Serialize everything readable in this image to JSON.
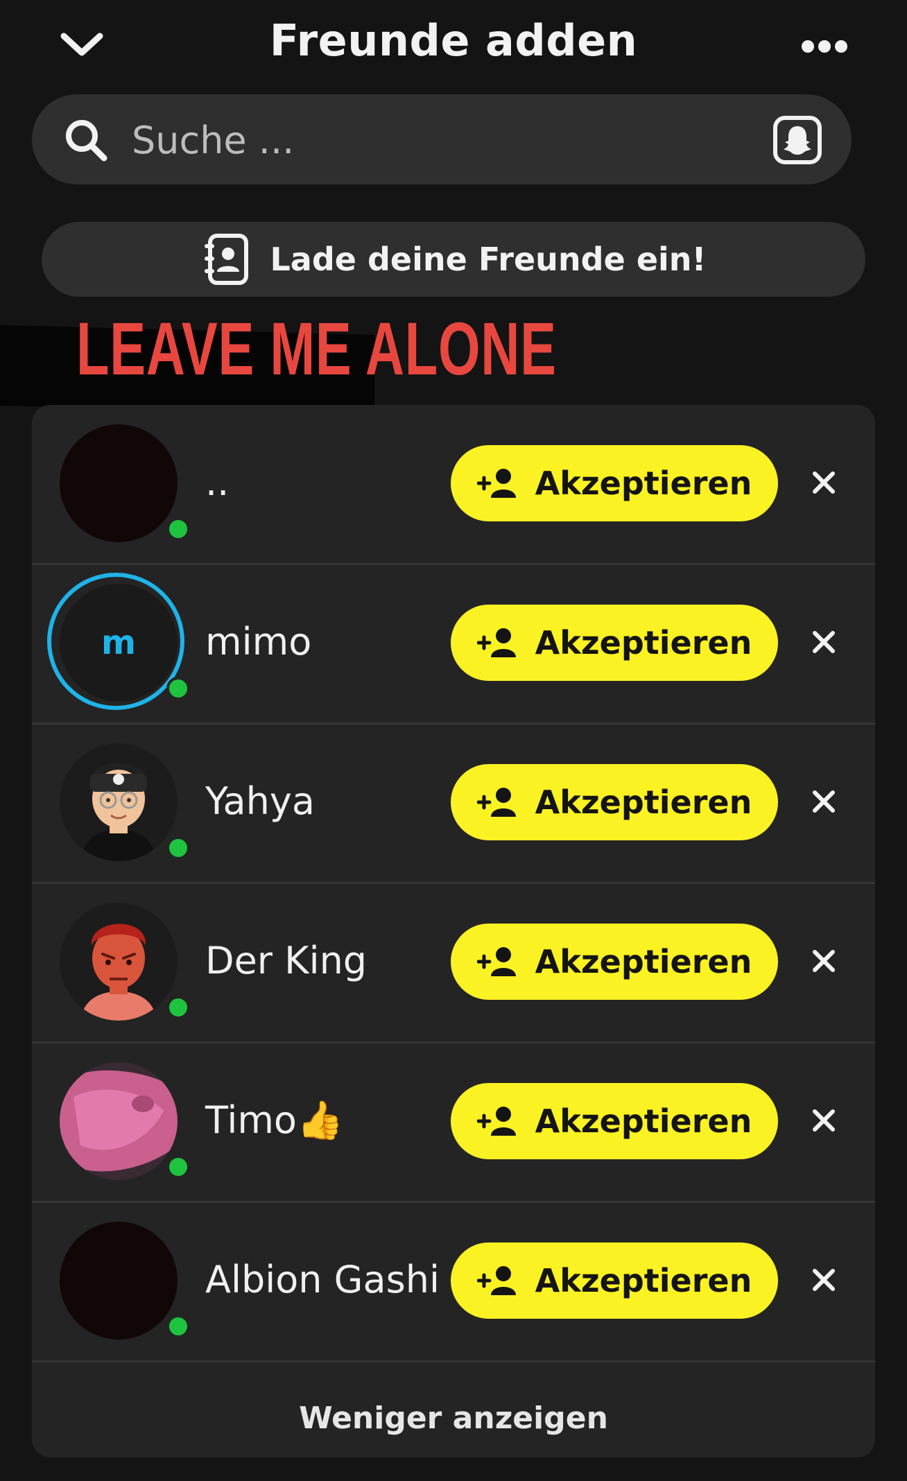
{
  "header": {
    "title": "Freunde adden"
  },
  "search": {
    "placeholder": "Suche ..."
  },
  "invite": {
    "label": "Lade deine Freunde ein!"
  },
  "banner": {
    "text": "LEAVE ME ALONE"
  },
  "requests": [
    {
      "name": "..",
      "online": true,
      "accept_label": "Akzeptieren"
    },
    {
      "name": "mimo",
      "avatar_letter": "m",
      "online": true,
      "accept_label": "Akzeptieren"
    },
    {
      "name": "Yahya",
      "online": true,
      "accept_label": "Akzeptieren"
    },
    {
      "name": "Der King",
      "online": true,
      "accept_label": "Akzeptieren"
    },
    {
      "name": "Timo👍",
      "online": true,
      "accept_label": "Akzeptieren"
    },
    {
      "name": "Albion Gashi",
      "online": true,
      "accept_label": "Akzeptieren"
    }
  ],
  "footer": {
    "show_less_label": "Weniger anzeigen"
  },
  "colors": {
    "background": "#141414",
    "accent_yellow": "#fbf224",
    "online_green": "#1ec43f",
    "banner_red": "#e8473f",
    "ring_blue": "#1fb3e8"
  }
}
